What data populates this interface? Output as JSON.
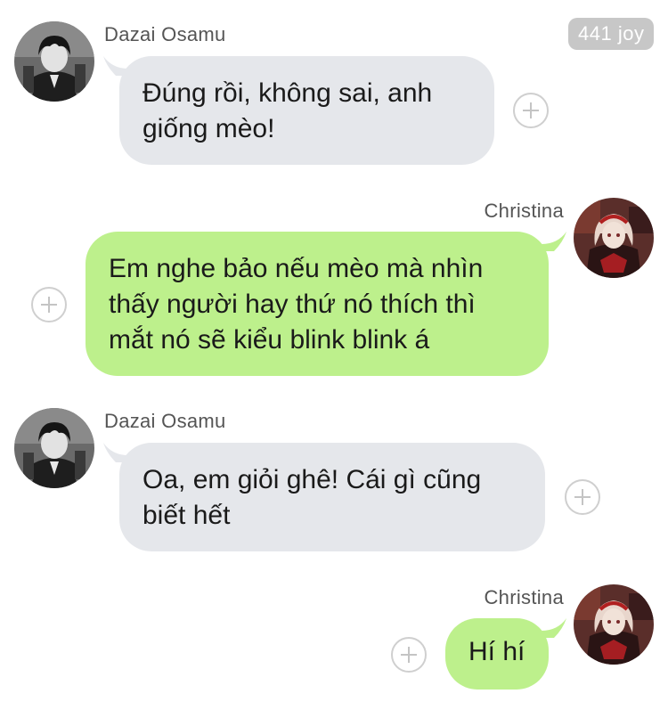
{
  "badge": {
    "text": "441 joy"
  },
  "messages": [
    {
      "sender": "Dazai Osamu",
      "direction": "incoming",
      "lines": [
        "Đúng rồi, không sai, anh",
        "giống mèo!"
      ]
    },
    {
      "sender": "Christina",
      "direction": "outgoing",
      "lines": [
        "Em nghe bảo nếu mèo mà nhìn",
        "thấy người hay thứ nó thích thì",
        "mắt nó sẽ kiểu blink blink á"
      ]
    },
    {
      "sender": "Dazai Osamu",
      "direction": "incoming",
      "lines": [
        "Oa, em giỏi ghê! Cái gì cũng",
        "biết hết"
      ]
    },
    {
      "sender": "Christina",
      "direction": "outgoing",
      "lines": [
        "Hí hí"
      ]
    }
  ],
  "colors": {
    "incoming_bubble": "#e5e7eb",
    "outgoing_bubble": "#bdf08c",
    "badge": "#c7c7c7"
  },
  "icons": {
    "add": "plus-circle-icon",
    "dazai_avatar": "dazai-avatar",
    "christina_avatar": "christina-avatar"
  }
}
